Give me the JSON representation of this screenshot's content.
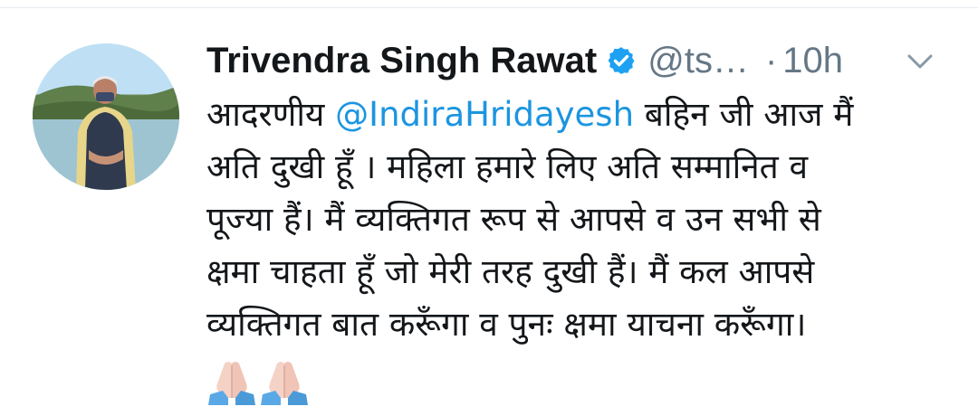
{
  "tweet": {
    "author_name": "Trivendra Singh Rawat",
    "handle": "@ts…",
    "separator": "·",
    "time": "10h",
    "avatar_icon": "profile-photo",
    "verified_icon": "verified-badge-icon",
    "menu_icon": "chevron-down-icon",
    "text": {
      "line1_prefix": "आदरणीय ",
      "mention": "@IndiraHridayesh",
      "line1_suffix": " बहिन जी आज मैं",
      "line2": "अति दुखी हूँ । महिला हमारे लिए अति सम्मानित व",
      "line3": "पूज्या हैं। मैं व्यक्तिगत रूप से आपसे व उन सभी से",
      "line4": "क्षमा चाहता हूँ जो मेरी तरह दुखी हैं। मैं कल आपसे",
      "line5": "व्यक्तिगत बात करूँगा व पुनः क्षमा याचना करूँगा।"
    },
    "emojis": [
      "folded-hands-emoji",
      "folded-hands-emoji"
    ],
    "colors": {
      "name": "#14171a",
      "meta": "#657786",
      "mention": "#1b95e0",
      "verified": "#1da1f2"
    }
  }
}
